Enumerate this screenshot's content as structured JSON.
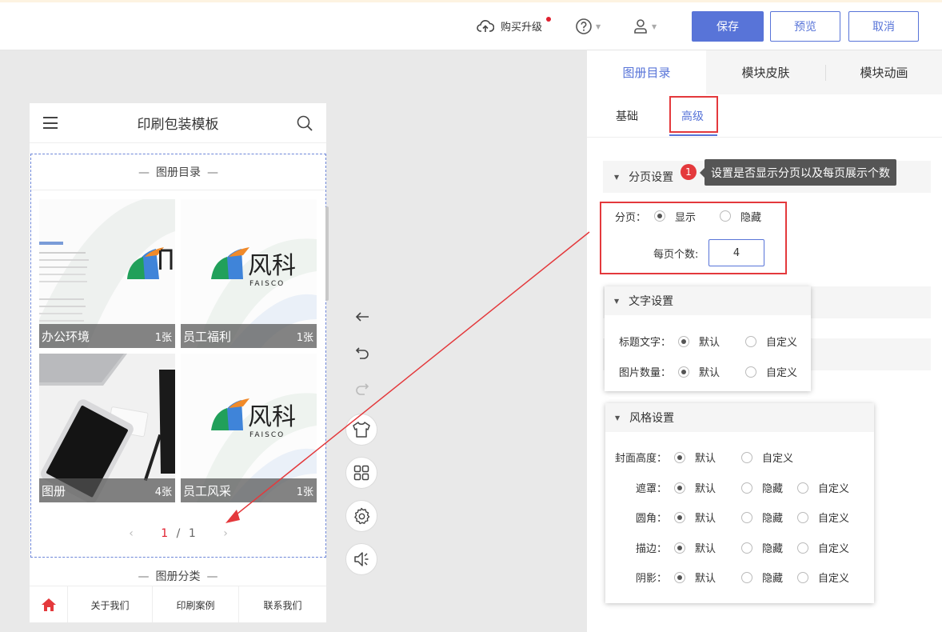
{
  "topbar": {
    "upgrade_label": "购买升级",
    "save_label": "保存",
    "preview_label": "预览",
    "cancel_label": "取消"
  },
  "phone": {
    "title": "印刷包装模板",
    "module_title": "图册目录",
    "cards": [
      {
        "name": "办公环境",
        "count": "1张"
      },
      {
        "name": "员工福利",
        "count": "1张"
      },
      {
        "name": "图册",
        "count": "4张"
      },
      {
        "name": "员工风采",
        "count": "1张"
      }
    ],
    "logo_text": "风科",
    "logo_sub": "FAISCO",
    "pager": {
      "current": "1",
      "separator": "/",
      "total": "1"
    },
    "category_title": "图册分类",
    "nav": [
      "关于我们",
      "印刷案例",
      "联系我们"
    ]
  },
  "panel": {
    "tabs": [
      "图册目录",
      "模块皮肤",
      "模块动画"
    ],
    "subtabs": [
      "基础",
      "高级"
    ],
    "pagination": {
      "section_title": "分页设置",
      "badge": "1",
      "tooltip": "设置是否显示分页以及每页展示个数",
      "label": "分页：",
      "show": "显示",
      "hide": "隐藏",
      "per_page_label": "每页个数:",
      "per_page_value": "4"
    },
    "text_settings": {
      "title": "文字设置",
      "rows": [
        {
          "label": "标题文字：",
          "opt1": "默认",
          "opt2": "自定义"
        },
        {
          "label": "图片数量：",
          "opt1": "默认",
          "opt2": "自定义"
        }
      ]
    },
    "style_settings": {
      "title": "风格设置",
      "cover": {
        "label": "封面高度：",
        "opt1": "默认",
        "opt2": "自定义"
      },
      "rows": [
        {
          "label": "遮罩：",
          "opt1": "默认",
          "opt2": "隐藏",
          "opt3": "自定义"
        },
        {
          "label": "圆角：",
          "opt1": "默认",
          "opt2": "隐藏",
          "opt3": "自定义"
        },
        {
          "label": "描边：",
          "opt1": "默认",
          "opt2": "隐藏",
          "opt3": "自定义"
        },
        {
          "label": "阴影：",
          "opt1": "默认",
          "opt2": "隐藏",
          "opt3": "自定义"
        }
      ]
    }
  },
  "colors": {
    "accent": "#5874d8",
    "highlight": "#e4393c",
    "pager_current": "#e0202f"
  }
}
